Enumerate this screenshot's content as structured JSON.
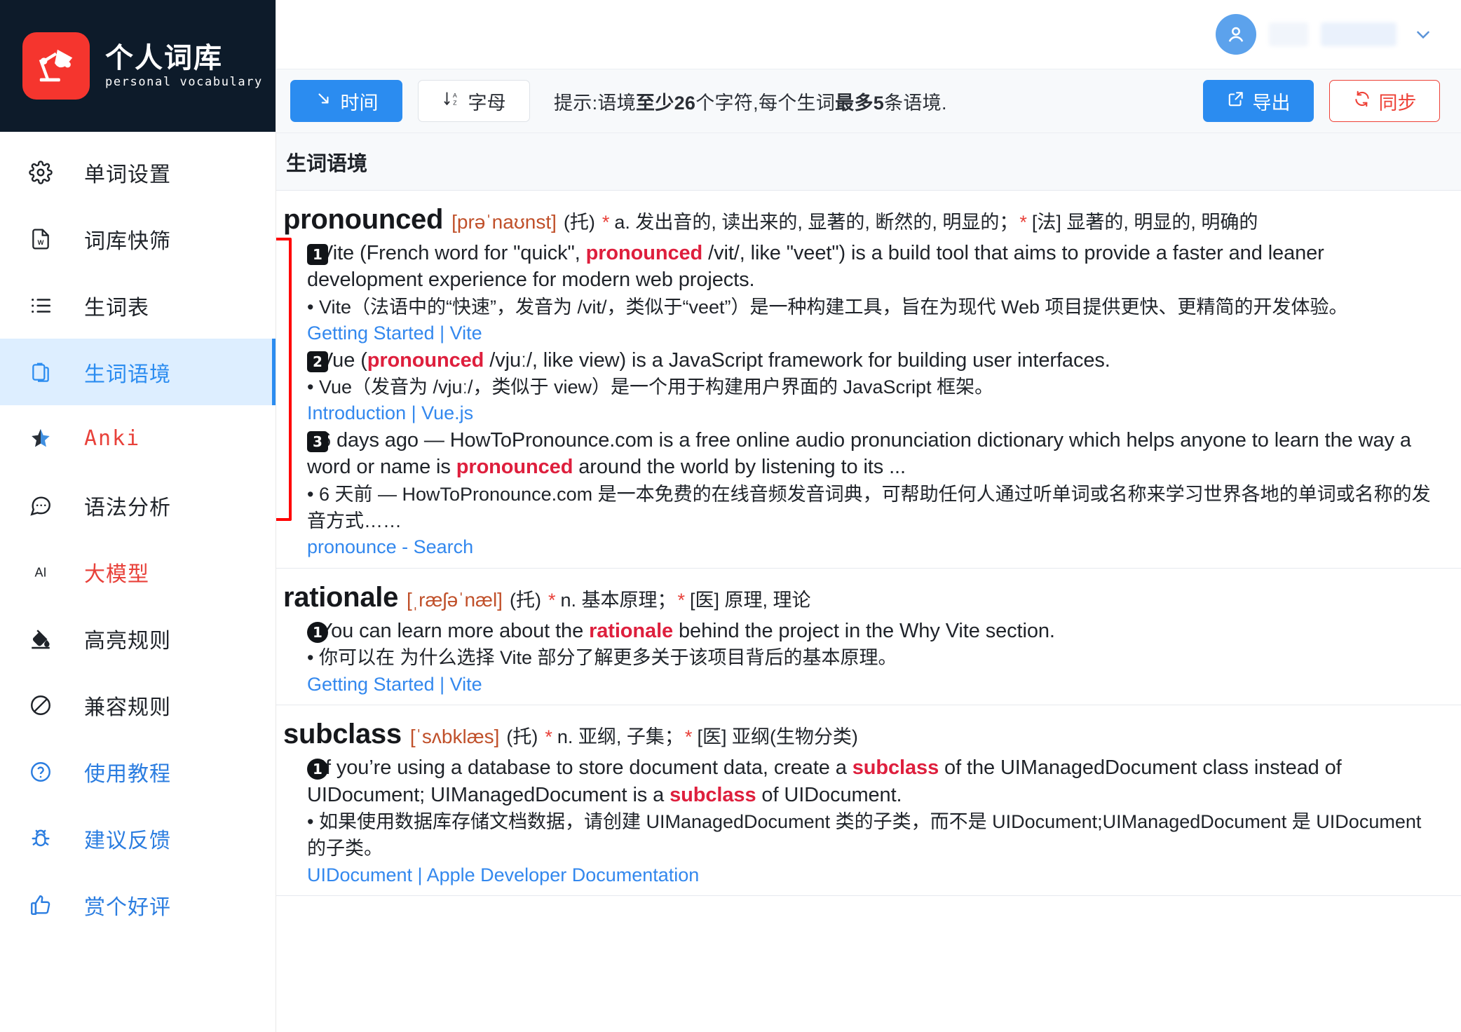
{
  "brand": {
    "title": "个人词库",
    "subtitle": "personal vocabulary",
    "logo_icon": "desk-lamp-icon",
    "bg_color": "#0d1b2a",
    "logo_color": "#f5352e"
  },
  "sidebar": {
    "items": [
      {
        "label": "单词设置",
        "icon": "gear-icon",
        "style": "dark",
        "active": false
      },
      {
        "label": "词库快筛",
        "icon": "word-file-icon",
        "style": "dark",
        "active": false
      },
      {
        "label": "生词表",
        "icon": "list-icon",
        "style": "dark",
        "active": false
      },
      {
        "label": "生词语境",
        "icon": "clipboard-copy-icon",
        "style": "active",
        "active": true
      },
      {
        "label": "Anki",
        "icon": "anki-star-icon",
        "style": "red",
        "active": false
      },
      {
        "label": "语法分析",
        "icon": "chat-dots-icon",
        "style": "dark",
        "active": false
      },
      {
        "label": "大模型",
        "icon": "ai-text-icon",
        "style": "red",
        "active": false
      },
      {
        "label": "高亮规则",
        "icon": "paint-bucket-icon",
        "style": "dark",
        "active": false
      },
      {
        "label": "兼容规则",
        "icon": "ban-icon",
        "style": "dark",
        "active": false
      },
      {
        "label": "使用教程",
        "icon": "question-circle-icon",
        "style": "blue",
        "active": false
      },
      {
        "label": "建议反馈",
        "icon": "bug-icon",
        "style": "blue",
        "active": false
      },
      {
        "label": "赏个好评",
        "icon": "thumbs-up-icon",
        "style": "blue",
        "active": false
      }
    ]
  },
  "topbar": {
    "avatar_icon": "user-avatar-icon",
    "chevron_icon": "chevron-down-icon"
  },
  "toolbar": {
    "sort_time_label": "时间",
    "sort_time_icon": "arrow-down-right-icon",
    "sort_alpha_label": "字母",
    "sort_alpha_icon": "sort-alpha-icon",
    "hint_prefix": "提示:语境",
    "hint_bold_1": "至少26",
    "hint_mid": "个字符,每个生词",
    "hint_bold_2": "最多5",
    "hint_suffix": "条语境.",
    "export_label": "导出",
    "export_icon": "external-link-icon",
    "sync_label": "同步",
    "sync_icon": "refresh-icon",
    "accent_blue": "#2b8cf0",
    "accent_red": "#ee4036"
  },
  "section": {
    "title": "生词语境"
  },
  "entries": [
    {
      "word": "pronounced",
      "phonetic": "[prəˈnaʊnst]",
      "pos": "(托)",
      "def_1": "a. 发出音的, 读出来的, 显著的, 断然的, 明显的；",
      "def_2": "[法] 显著的, 明显的, 明确的",
      "contexts": [
        {
          "num": "1",
          "en_pre": "• Vite (French word for \"quick\", ",
          "en_hl": "pronounced",
          "en_post": " /vit/, like \"veet\") is a build tool that aims to provide a faster and leaner development experience for modern web projects.",
          "zh": "• Vite（法语中的“快速”，发音为 /vit/，类似于“veet”）是一种构建工具，旨在为现代 Web 项目提供更快、更精简的开发体验。",
          "source": "Getting Started | Vite"
        },
        {
          "num": "2",
          "en_pre": "• Vue (",
          "en_hl": "pronounced",
          "en_post": " /vjuː/, like view) is a JavaScript framework for building user interfaces.",
          "zh": "• Vue（发音为 /vjuː/，类似于 view）是一个用于构建用户界面的 JavaScript 框架。",
          "source": "Introduction | Vue.js"
        },
        {
          "num": "3",
          "en_pre": "• 6 days ago — HowToPronounce.com is a free online audio pronunciation dictionary which helps anyone to learn the way a word or name is ",
          "en_hl": "pronounced",
          "en_post": " around the world by listening to its ...",
          "zh": "• 6 天前 — HowToPronounce.com 是一本免费的在线音频发音词典，可帮助任何人通过听单词或名称来学习世界各地的单词或名称的发音方式……",
          "source": "pronounce - Search"
        }
      ]
    },
    {
      "word": "rationale",
      "phonetic": "[ˌræʃəˈnæl]",
      "pos": "(托)",
      "def_1": "n. 基本原理；",
      "def_2": "[医] 原理, 理论",
      "contexts": [
        {
          "num": "1",
          "en_pre": "• You can learn more about the ",
          "en_hl": "rationale",
          "en_post": " behind the project in the Why Vite section.",
          "zh": "• 你可以在 为什么选择 Vite 部分了解更多关于该项目背后的基本原理。",
          "source": "Getting Started | Vite"
        }
      ]
    },
    {
      "word": "subclass",
      "phonetic": "[ˈsʌbklæs]",
      "pos": "(托)",
      "def_1": "n. 亚纲, 子集；",
      "def_2": "[医] 亚纲(生物分类)",
      "contexts": [
        {
          "num": "1",
          "en_pre": "• If you’re using a database to store document data, create a ",
          "en_hl": "subclass",
          "en_post": " of the UIManagedDocument class instead of UIDocument; UIManagedDocument is a ",
          "en_hl2": "subclass",
          "en_post2": " of UIDocument.",
          "zh": "• 如果使用数据库存储文档数据，请创建 UIManagedDocument 类的子类，而不是 UIDocument;UIManagedDocument 是 UIDocument 的子类。",
          "source": "UIDocument | Apple Developer Documentation"
        }
      ]
    }
  ],
  "annotation": {
    "color": "#ff0000",
    "shape": "rectangle",
    "target": "context-number-badges"
  },
  "def_marker": "*"
}
